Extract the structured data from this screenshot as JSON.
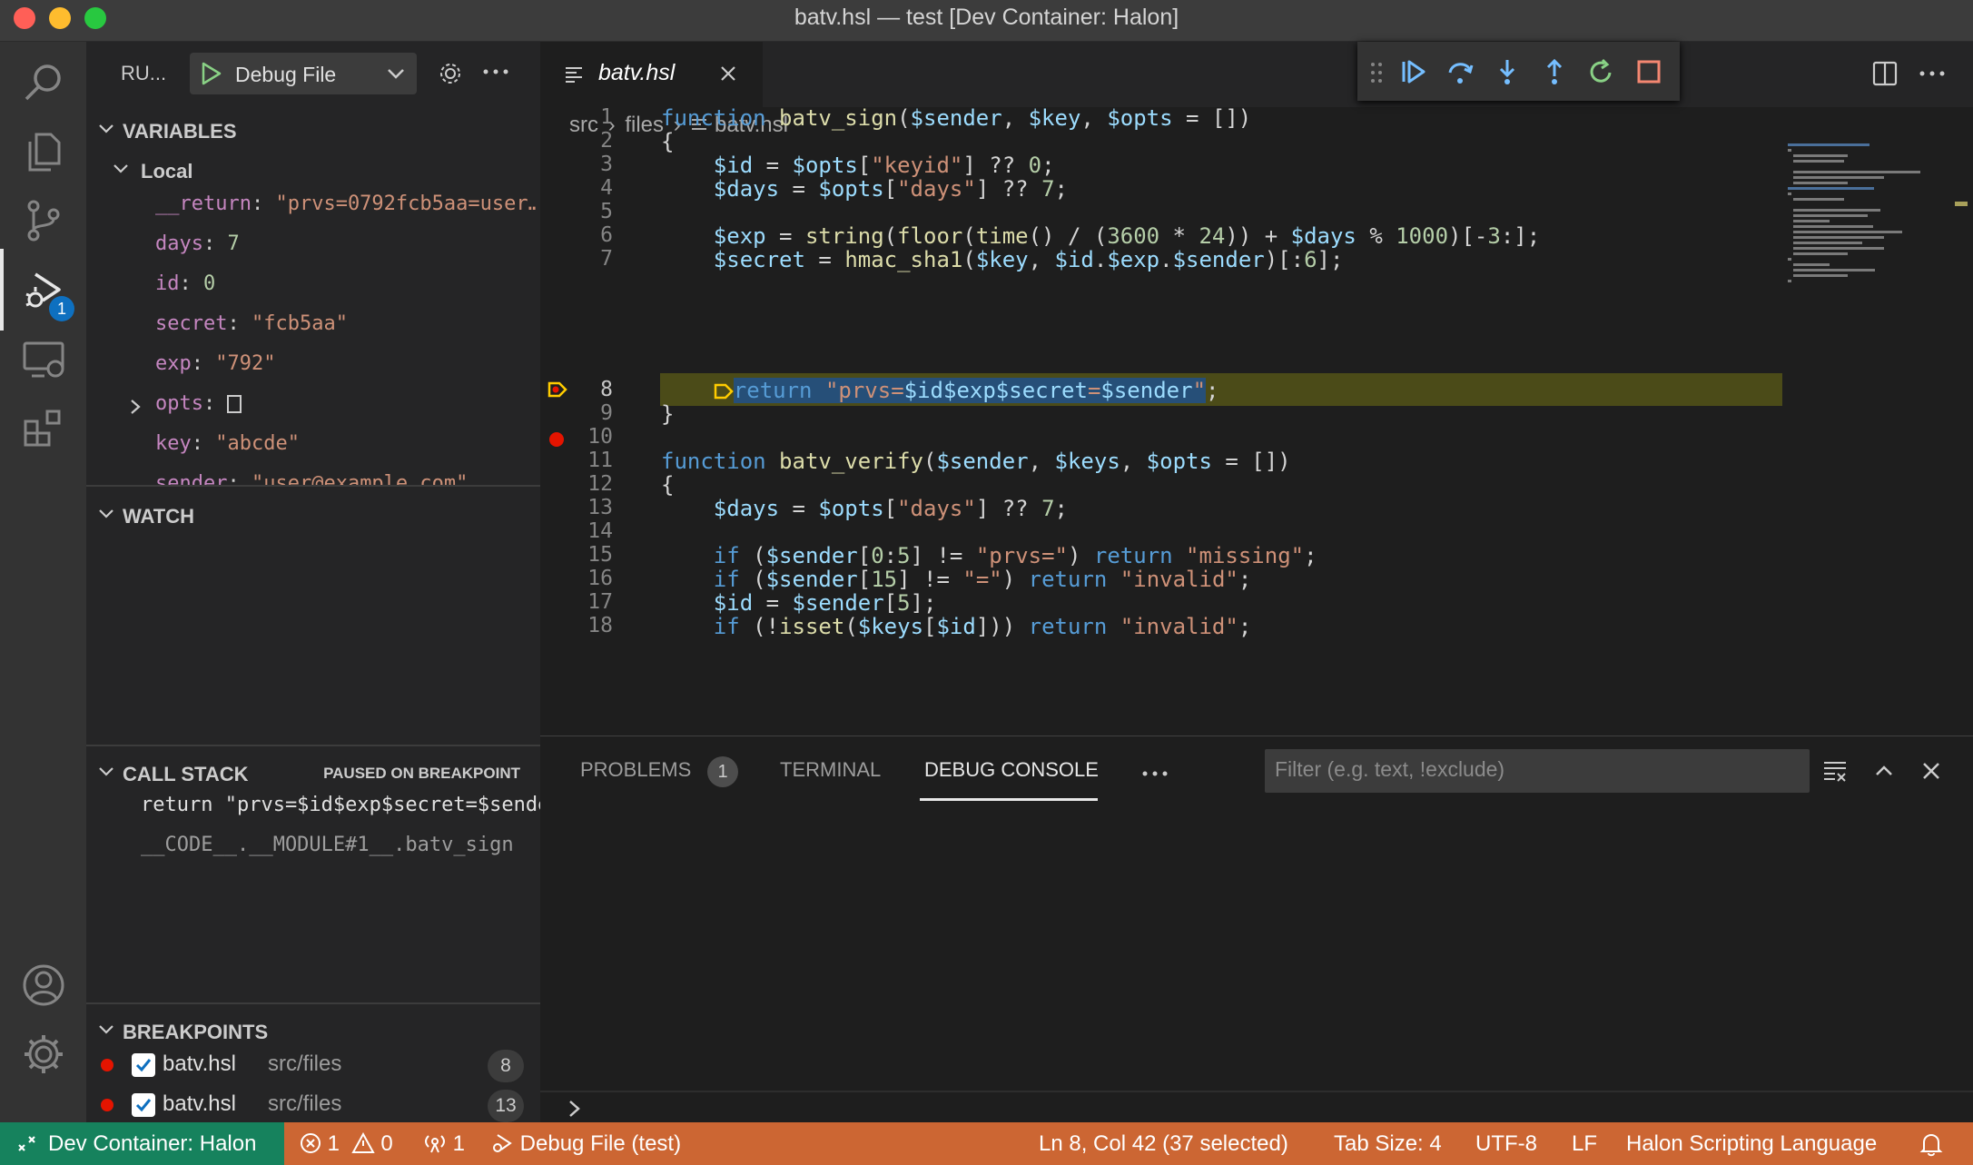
{
  "window": {
    "title": "batv.hsl — test [Dev Container: Halon]"
  },
  "activity_bar": {
    "debug_badge": "1"
  },
  "sidebar": {
    "run_label": "RU...",
    "config_name": "Debug File",
    "variables": {
      "header": "VARIABLES",
      "scope": "Local",
      "items": [
        {
          "name": "__return",
          "value": "\"prvs=0792fcb5aa=user…"
        },
        {
          "name": "days",
          "value": "7"
        },
        {
          "name": "id",
          "value": "0"
        },
        {
          "name": "secret",
          "value": "\"fcb5aa\""
        },
        {
          "name": "exp",
          "value": "\"792\""
        },
        {
          "name": "opts",
          "value": "[]"
        },
        {
          "name": "key",
          "value": "\"abcde\""
        },
        {
          "name": "sender",
          "value": "\"user@example.com\""
        }
      ]
    },
    "watch": {
      "header": "WATCH"
    },
    "call_stack": {
      "header": "CALL STACK",
      "status": "PAUSED ON BREAKPOINT",
      "frames": [
        "return \"prvs=$id$exp$secret=$sender\";",
        "__CODE__.__MODULE#1__.batv_sign"
      ]
    },
    "breakpoints": {
      "header": "BREAKPOINTS",
      "items": [
        {
          "file": "batv.hsl",
          "path": "src/files",
          "line": "8"
        },
        {
          "file": "batv.hsl",
          "path": "src/files",
          "line": "13"
        }
      ]
    }
  },
  "editor": {
    "tab_label": "batv.hsl",
    "breadcrumb": {
      "a": "src",
      "b": "files",
      "c": "batv.hsl"
    },
    "line_numbers": [
      "1",
      "2",
      "3",
      "4",
      "5",
      "6",
      "7",
      "8",
      "9",
      "10",
      "11",
      "12",
      "13",
      "14",
      "15",
      "16",
      "17",
      "18"
    ],
    "current_line": 8,
    "breakpoint_lines": [
      8,
      13
    ]
  },
  "panel": {
    "tabs": {
      "problems": "PROBLEMS",
      "terminal": "TERMINAL",
      "debug_console": "DEBUG CONSOLE"
    },
    "problems_count": "1",
    "filter_placeholder": "Filter (e.g. text, !exclude)"
  },
  "status_bar": {
    "remote": "Dev Container: Halon",
    "errors": "1",
    "warnings": "0",
    "ports": "1",
    "debug": "Debug File (test)",
    "position": "Ln 8, Col 42 (37 selected)",
    "tab_size": "Tab Size: 4",
    "encoding": "UTF-8",
    "eol": "LF",
    "language": "Halon Scripting Language"
  },
  "colors": {
    "status_bar": "#cc6633",
    "remote": "#16825d",
    "accent": "#0e70c0",
    "breakpoint": "#e51400"
  }
}
